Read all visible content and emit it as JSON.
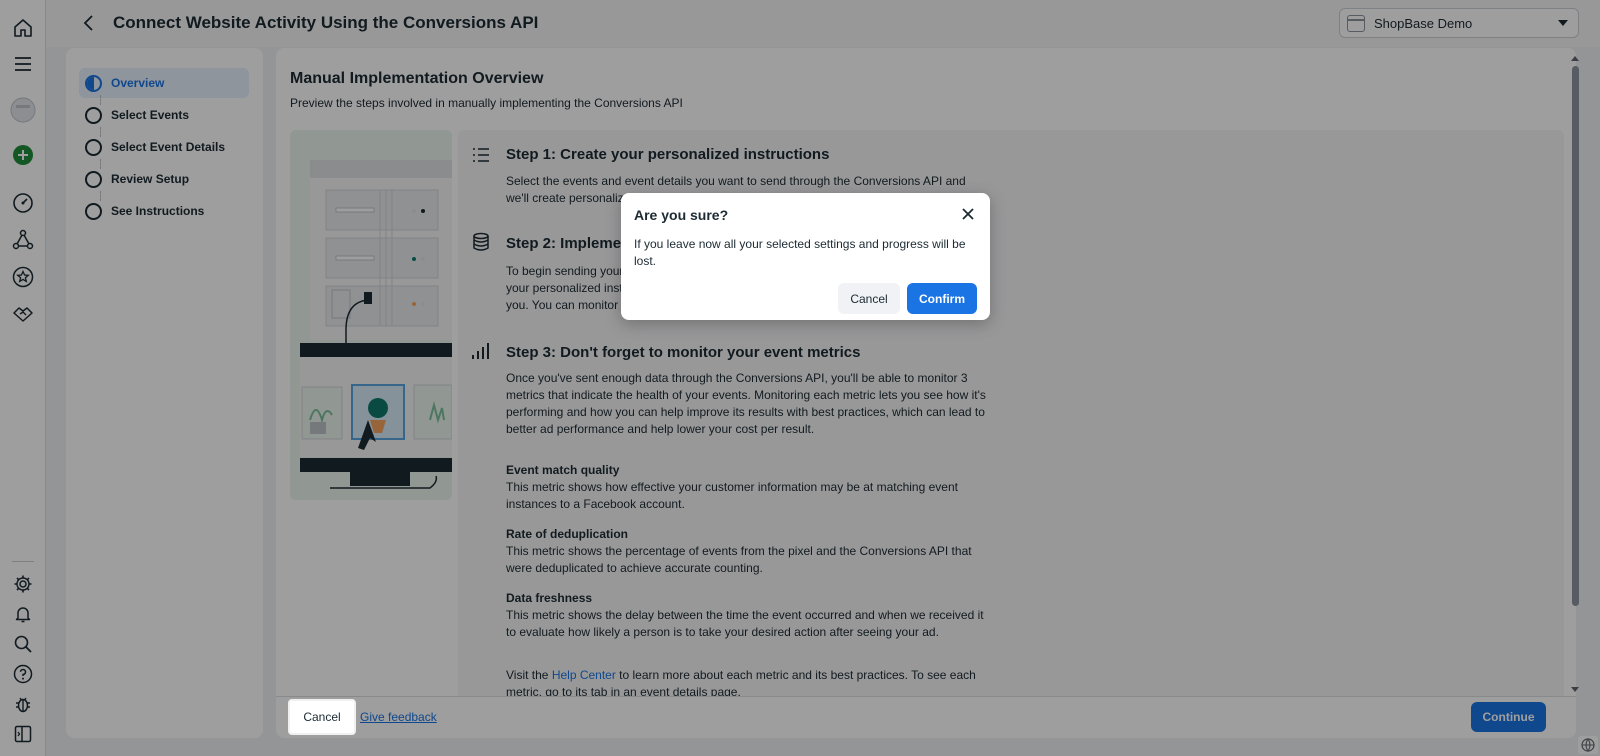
{
  "header": {
    "title": "Connect Website Activity Using the Conversions API",
    "account_name": "ShopBase Demo"
  },
  "rail": {
    "icons": [
      "home-icon",
      "menu-icon",
      "avatar",
      "add-icon",
      "dashboard-icon",
      "events-manager-icon",
      "star-icon",
      "handshake-icon",
      "settings-icon",
      "notifications-icon",
      "search-icon",
      "help-icon",
      "bug-icon",
      "panel-toggle-icon"
    ]
  },
  "steps": {
    "items": [
      {
        "label": "Overview"
      },
      {
        "label": "Select Events"
      },
      {
        "label": "Select Event Details"
      },
      {
        "label": "Review Setup"
      },
      {
        "label": "See Instructions"
      }
    ]
  },
  "main": {
    "title": "Manual Implementation Overview",
    "subtitle": "Preview the steps involved in manually implementing the Conversions API",
    "step1": {
      "heading": "Step 1: Create your personalized instructions",
      "text": "Select the events and event details you want to send through the Conversions API and we'll create personalized, s"
    },
    "step2": {
      "heading": "Step 2: Implemen",
      "text_line1": "To begin sending your",
      "text_line2": "your personalized inst",
      "text_line3": "you. You can monitor t"
    },
    "step3": {
      "heading": "Step 3: Don't forget to monitor your event metrics",
      "text": "Once you've sent enough data through the Conversions API, you'll be able to monitor 3 metrics that indicate the health of your events. Monitoring each metric lets you see how it's performing and how you can help improve its results with best practices, which can lead to better ad performance and help lower your cost per result."
    },
    "metrics": [
      {
        "title": "Event match quality",
        "text": "This metric shows how effective your customer information may be at matching event instances to a Facebook account."
      },
      {
        "title": "Rate of deduplication",
        "text": "This metric shows the percentage of events from the pixel and the Conversions API that were deduplicated to achieve accurate counting."
      },
      {
        "title": "Data freshness",
        "text": "This metric shows the delay between the time the event occurred and when we received it to evaluate how likely a person is to take your desired action after seeing your ad."
      }
    ],
    "help": {
      "prefix": "Visit the ",
      "link": "Help Center",
      "suffix": " to learn more about each metric and its best practices. To see each metric, go to its tab in an event details page."
    }
  },
  "footer": {
    "cancel_label": "Cancel",
    "feedback_label": "Give feedback",
    "continue_label": "Continue"
  },
  "dialog": {
    "title": "Are you sure?",
    "body": "If you leave now all your selected settings and progress will be lost.",
    "cancel_label": "Cancel",
    "confirm_label": "Confirm"
  },
  "colors": {
    "accent": "#1b74e4",
    "add_button": "#1f8f3a"
  }
}
